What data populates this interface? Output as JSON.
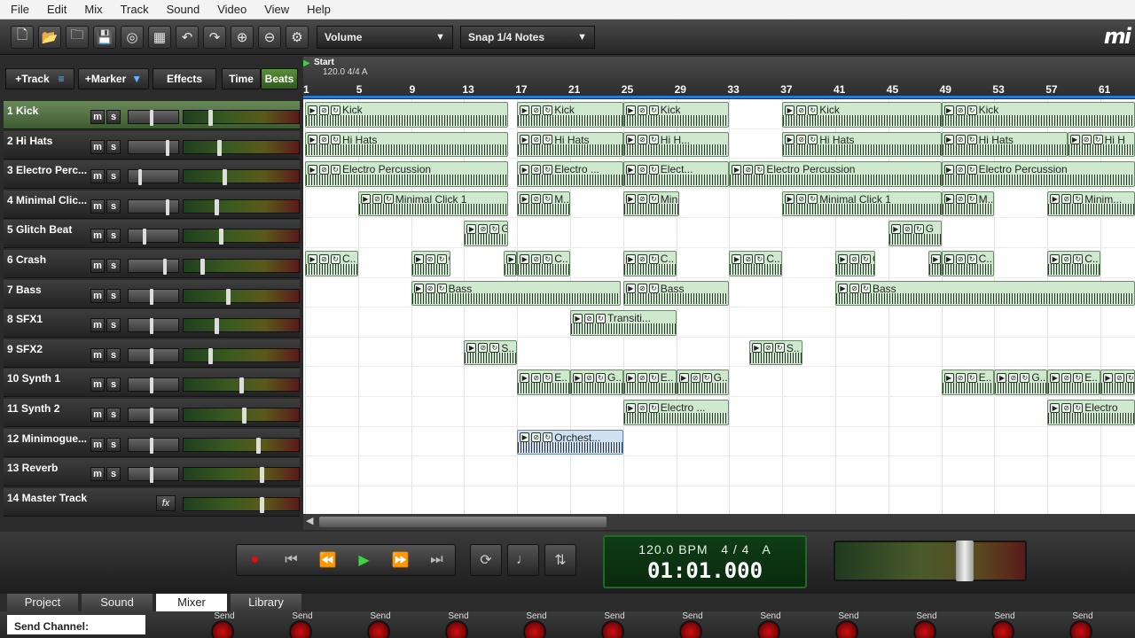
{
  "menu": [
    "File",
    "Edit",
    "Mix",
    "Track",
    "Sound",
    "Video",
    "View",
    "Help"
  ],
  "toolbar": {
    "volume_combo": "Volume",
    "snap_combo": "Snap 1/4 Notes",
    "brand": "mi"
  },
  "track_header": {
    "add_track": "+Track",
    "add_marker": "+Marker",
    "effects": "Effects",
    "time": "Time",
    "beats": "Beats"
  },
  "tracks": [
    {
      "name": "1 Kick",
      "fader": 0.45,
      "meter": 0.22
    },
    {
      "name": "2 Hi Hats",
      "fader": 0.78,
      "meter": 0.3
    },
    {
      "name": "3 Electro Perc...",
      "fader": 0.2,
      "meter": 0.35
    },
    {
      "name": "4 Minimal Clic...",
      "fader": 0.78,
      "meter": 0.28
    },
    {
      "name": "5 Glitch Beat",
      "fader": 0.3,
      "meter": 0.32
    },
    {
      "name": "6 Crash",
      "fader": 0.72,
      "meter": 0.15
    },
    {
      "name": "7 Bass",
      "fader": 0.45,
      "meter": 0.38
    },
    {
      "name": "8 SFX1",
      "fader": 0.45,
      "meter": 0.28
    },
    {
      "name": "9 SFX2",
      "fader": 0.45,
      "meter": 0.22
    },
    {
      "name": "10 Synth 1",
      "fader": 0.45,
      "meter": 0.5
    },
    {
      "name": "11 Synth 2",
      "fader": 0.45,
      "meter": 0.52
    },
    {
      "name": "12 Minimogue...",
      "fader": 0.45,
      "meter": 0.65
    },
    {
      "name": "13 Reverb",
      "fader": 0.45,
      "meter": 0.68
    },
    {
      "name": "14 Master Track",
      "fader": null,
      "meter": 0.68
    }
  ],
  "timeline": {
    "start_label": "Start",
    "tempo_label": "120.0 4/4 A",
    "bars": [
      "1",
      "5",
      "9",
      "13",
      "17",
      "21",
      "25",
      "29",
      "33",
      "37",
      "41",
      "45",
      "49",
      "53",
      "57",
      "61"
    ]
  },
  "clips": {
    "kick": "Kick",
    "hihats": "Hi Hats",
    "hihats_short": "Hi H...",
    "hihats_end": "Hi H",
    "electro": "Electro Percussion",
    "electro_short": "Electro ...",
    "electro_short2": "Elect...",
    "minimal": "Minimal Click 1",
    "minimal_short": "M..",
    "minimal_short2": "Mini...",
    "minimal_short3": "Minim...",
    "glitch": "G",
    "crash": "C..",
    "bass": "Bass",
    "transition": "Transiti...",
    "sfx2": "S..",
    "synth1_e": "E..",
    "synth1_g": "G..",
    "synth2": "Electro ...",
    "synth2_end": "Electro",
    "orchestra": "Orchest..."
  },
  "transport": {
    "bpm": "120.0 BPM",
    "timesig": "4 / 4",
    "key": "A",
    "time": "01:01.000",
    "master_volume": 0.68
  },
  "tabs": [
    "Project",
    "Sound",
    "Mixer",
    "Library"
  ],
  "active_tab": "Mixer",
  "send": {
    "label": "Send Channel:",
    "cell_label": "Send"
  }
}
